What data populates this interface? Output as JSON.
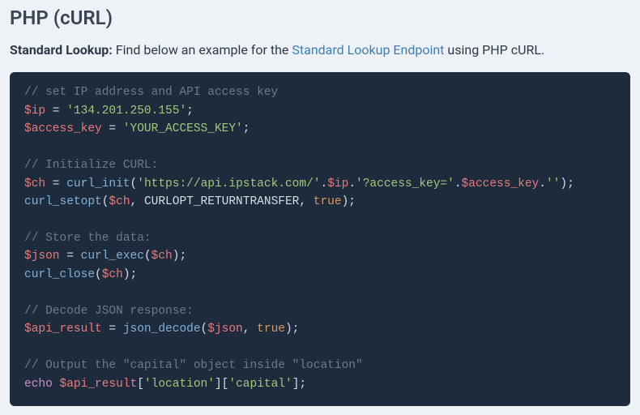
{
  "heading": "PHP (cURL)",
  "description": {
    "bold": "Standard Lookup:",
    "before_link": " Find below an example for the ",
    "link_text": "Standard Lookup Endpoint",
    "after_link": " using PHP cURL."
  },
  "code": {
    "c1": "// set IP address and API access key",
    "l2_var": "$ip",
    "l2_eq": " = ",
    "l2_str": "'134.201.250.155'",
    "l2_end": ";",
    "l3_var": "$access_key",
    "l3_eq": " = ",
    "l3_str": "'YOUR_ACCESS_KEY'",
    "l3_end": ";",
    "c2": "// Initialize CURL:",
    "l5_var": "$ch",
    "l5_eq": " = ",
    "l5_fn": "curl_init",
    "l5_p1": "(",
    "l5_s1": "'https://api.ipstack.com/'",
    "l5_dot1": ".",
    "l5_v2": "$ip",
    "l5_dot2": ".",
    "l5_s2": "'?access_key='",
    "l5_dot3": ".",
    "l5_v3": "$access_key",
    "l5_dot4": ".",
    "l5_s3": "''",
    "l5_p2": ");",
    "l6_fn": "curl_setopt",
    "l6_p1": "(",
    "l6_v1": "$ch",
    "l6_c1": ", ",
    "l6_const": "CURLOPT_RETURNTRANSFER",
    "l6_c2": ", ",
    "l6_bool": "true",
    "l6_p2": ");",
    "c3": "// Store the data:",
    "l8_var": "$json",
    "l8_eq": " = ",
    "l8_fn": "curl_exec",
    "l8_p1": "(",
    "l8_v1": "$ch",
    "l8_p2": ");",
    "l9_fn": "curl_close",
    "l9_p1": "(",
    "l9_v1": "$ch",
    "l9_p2": ");",
    "c4": "// Decode JSON response:",
    "l11_var": "$api_result",
    "l11_eq": " = ",
    "l11_fn": "json_decode",
    "l11_p1": "(",
    "l11_v1": "$json",
    "l11_c1": ", ",
    "l11_bool": "true",
    "l11_p2": ");",
    "c5": "// Output the \"capital\" object inside \"location\"",
    "l13_kw": "echo",
    "l13_sp": " ",
    "l13_var": "$api_result",
    "l13_b1": "[",
    "l13_s1": "'location'",
    "l13_b2": "][",
    "l13_s2": "'capital'",
    "l13_b3": "];"
  }
}
